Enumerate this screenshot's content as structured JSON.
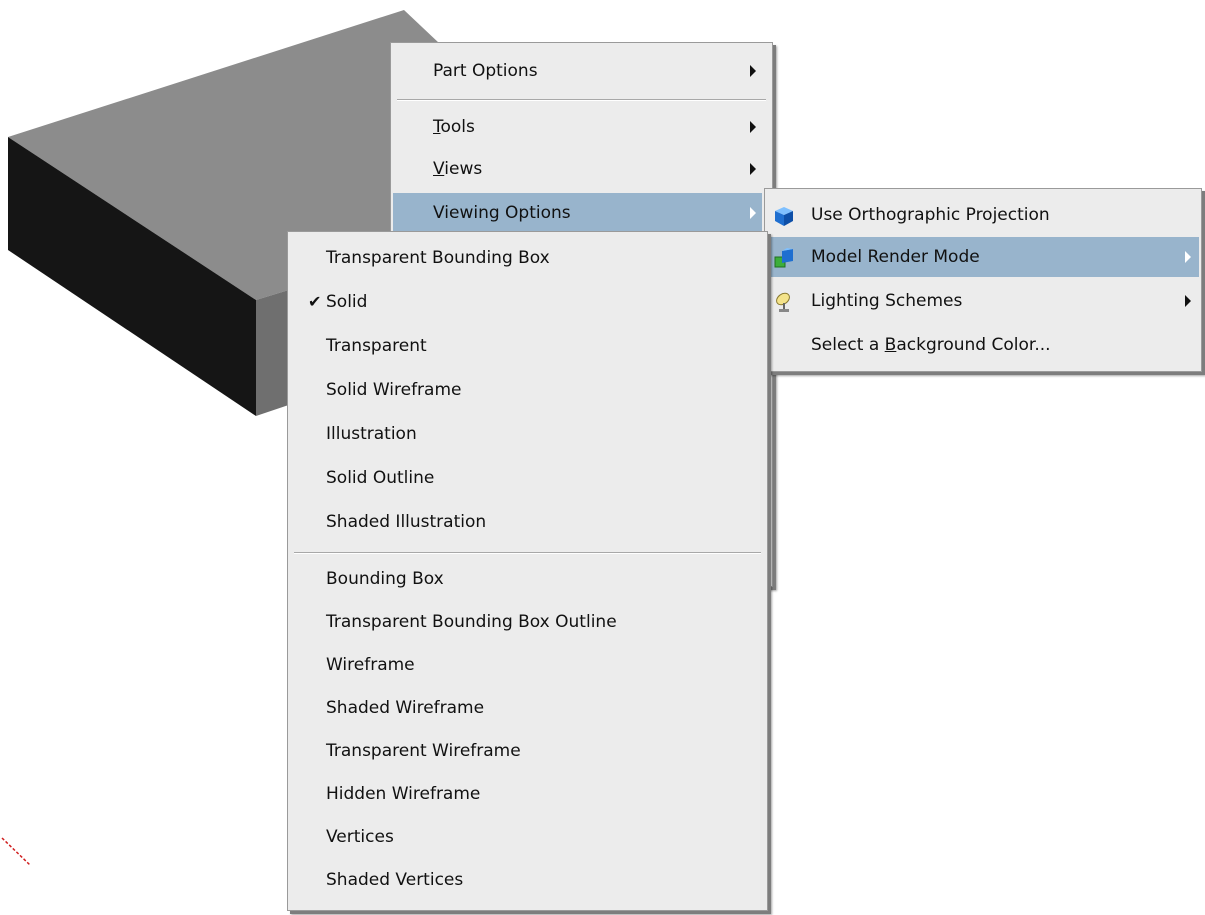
{
  "context_menu": {
    "items": [
      {
        "pre": "",
        "key": "",
        "post": "Part Options",
        "has_submenu": true
      },
      {
        "pre": "",
        "key": "T",
        "post": "ools",
        "has_submenu": true
      },
      {
        "pre": "",
        "key": "V",
        "post": "iews",
        "has_submenu": true
      },
      {
        "pre": "",
        "key": "",
        "post": "Viewing Options",
        "has_submenu": true,
        "highlighted": true
      }
    ]
  },
  "viewing_options_menu": {
    "items": [
      {
        "pre": "",
        "key": "",
        "post": "Use Orthographic Projection",
        "icon": "cube-icon"
      },
      {
        "pre": "",
        "key": "",
        "post": "Model Render Mode",
        "icon": "render-mode-icon",
        "has_submenu": true,
        "highlighted": true
      },
      {
        "pre": "",
        "key": "",
        "post": "Lighting Schemes",
        "icon": "lamp-icon",
        "has_submenu": true
      },
      {
        "pre": "Select a ",
        "key": "B",
        "post": "ackground Color..."
      }
    ]
  },
  "render_mode_menu": {
    "check_glyph": "✔",
    "items": [
      {
        "label": "Transparent Bounding Box",
        "checked": false
      },
      {
        "label": "Solid",
        "checked": true
      },
      {
        "label": "Transparent",
        "checked": false
      },
      {
        "label": "Solid Wireframe",
        "checked": false
      },
      {
        "label": "Illustration",
        "checked": false
      },
      {
        "label": "Solid Outline",
        "checked": false
      },
      {
        "label": "Shaded Illustration",
        "checked": false
      },
      {
        "label": "Bounding Box",
        "checked": false
      },
      {
        "label": "Transparent Bounding Box Outline",
        "checked": false
      },
      {
        "label": "Wireframe",
        "checked": false
      },
      {
        "label": "Shaded Wireframe",
        "checked": false
      },
      {
        "label": "Transparent Wireframe",
        "checked": false
      },
      {
        "label": "Hidden Wireframe",
        "checked": false
      },
      {
        "label": "Vertices",
        "checked": false
      },
      {
        "label": "Shaded Vertices",
        "checked": false
      }
    ]
  },
  "colors": {
    "menu_background": "#ececec",
    "highlight": "#98b4cc",
    "box_top": "#8c8c8c",
    "box_front": "#6f6f6f",
    "box_side": "#151515",
    "axis_red": "#d02020"
  }
}
